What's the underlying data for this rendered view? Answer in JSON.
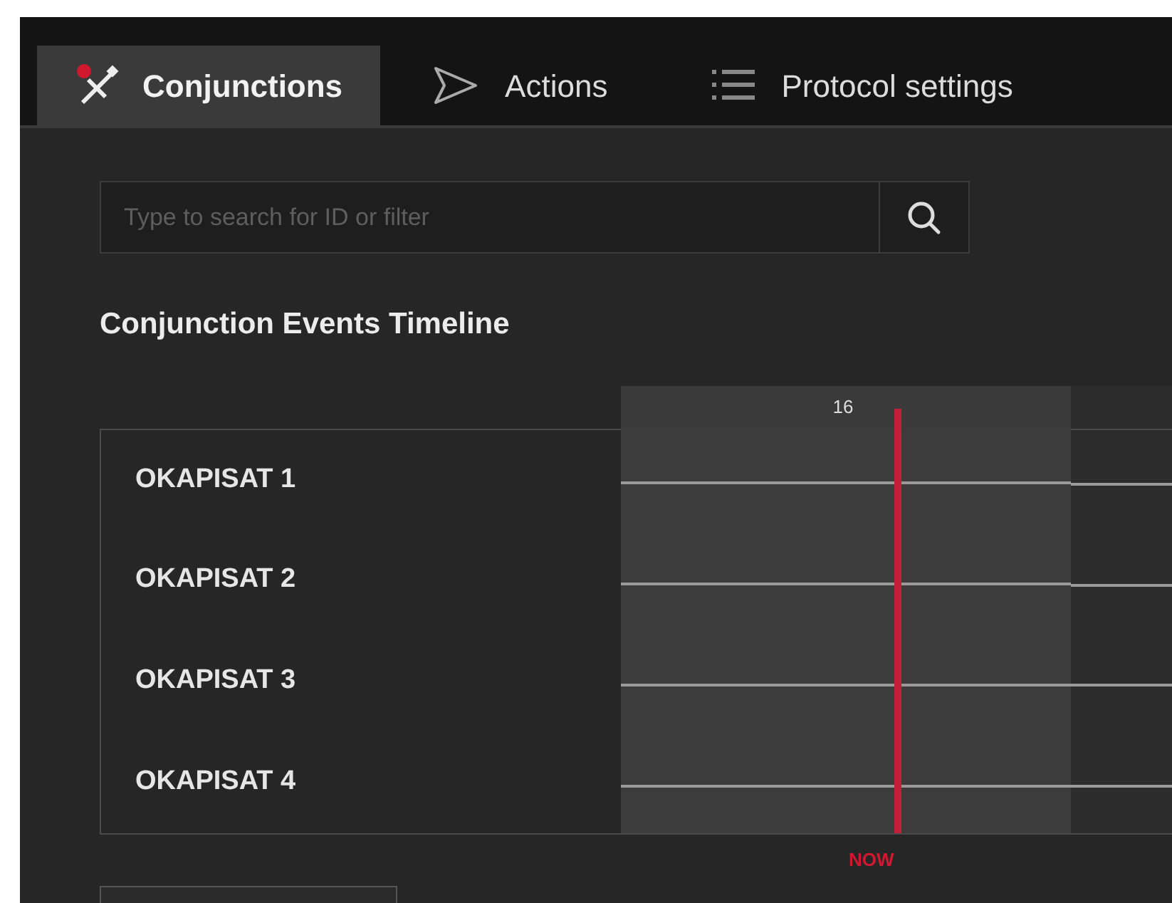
{
  "tabs": [
    {
      "label": "Conjunctions",
      "selected": true
    },
    {
      "label": "Actions",
      "selected": false
    },
    {
      "label": "Protocol settings",
      "selected": false
    }
  ],
  "search": {
    "placeholder": "Type to search for ID or filter"
  },
  "timeline": {
    "title": "Conjunction Events Timeline",
    "column_label": "16",
    "now_label": "NOW",
    "rows": [
      {
        "name": "OKAPISAT 1"
      },
      {
        "name": "OKAPISAT 2"
      },
      {
        "name": "OKAPISAT 3"
      },
      {
        "name": "OKAPISAT 4"
      }
    ]
  }
}
